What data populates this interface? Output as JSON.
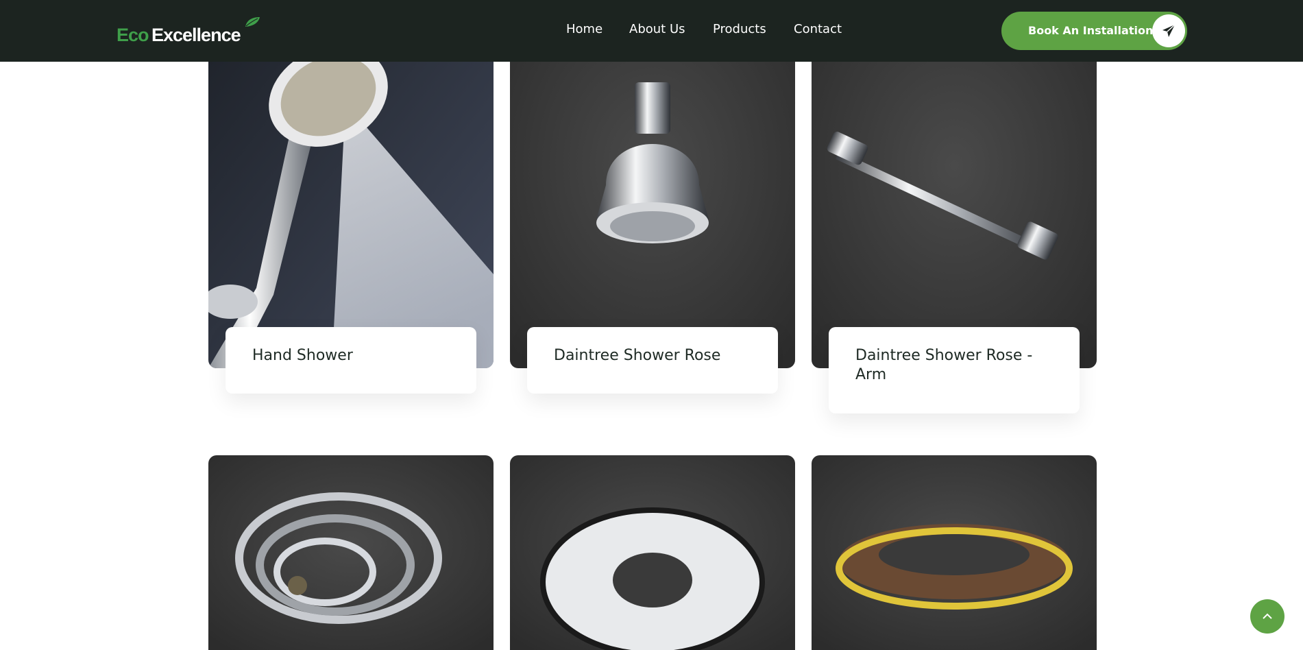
{
  "brand": {
    "logo_part1": "Eco",
    "logo_part2": "Excellence",
    "accent_color": "#5ea344",
    "nav_bg_color": "#1c2420"
  },
  "nav": {
    "links": [
      "Home",
      "About Us",
      "Products",
      "Contact"
    ],
    "cta_label": "Book An Installation",
    "cta_icon": "paper-plane-icon"
  },
  "products": [
    {
      "title": "Hand Shower",
      "image": "hand-shower-image"
    },
    {
      "title": "Daintree Shower Rose",
      "image": "shower-rose-image"
    },
    {
      "title": "Daintree Shower Rose - Arm",
      "image": "shower-arm-image"
    },
    {
      "title": "",
      "image": "shower-hose-image"
    },
    {
      "title": "",
      "image": "flange-cover-plate-image"
    },
    {
      "title": "",
      "image": "sealing-strip-image"
    }
  ],
  "scroll_top_icon": "chevron-up-icon"
}
